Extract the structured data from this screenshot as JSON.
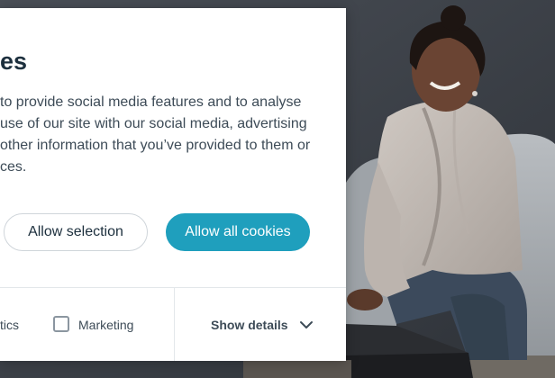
{
  "dialog": {
    "title": "es",
    "body_lines": [
      "to provide social media features and to analyse",
      "use of our site with our social media, advertising",
      "other information that you’ve provided to them or",
      "ces."
    ],
    "buttons": {
      "allow_selection": "Allow selection",
      "allow_all": "Allow all cookies"
    },
    "preferences": {
      "partial_label": "tics",
      "marketing_label": "Marketing",
      "marketing_checked": false
    },
    "show_details": {
      "label": "Show details",
      "icon": "chevron-down-icon"
    }
  },
  "background": {
    "icon": "photo-woman-with-laptop"
  },
  "colors": {
    "accent": "#1f9fbd",
    "title": "#1c2f3d",
    "text": "#3d4b57",
    "divider": "#e3e7ea"
  }
}
